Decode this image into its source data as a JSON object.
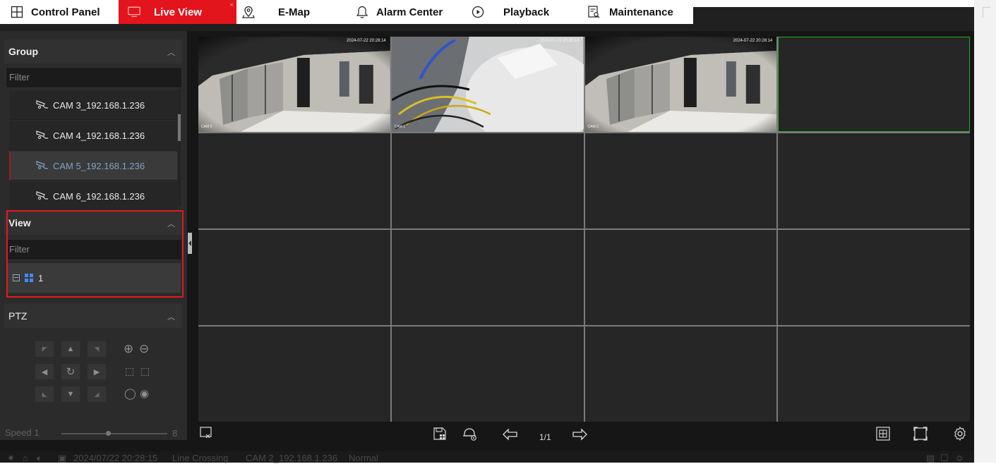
{
  "tabs": [
    {
      "label": "Control Panel",
      "icon": "grid-icon"
    },
    {
      "label": "Live View",
      "icon": "monitor-icon",
      "close": "×"
    },
    {
      "label": "E-Map",
      "icon": "map-pin-icon"
    },
    {
      "label": "Alarm Center",
      "icon": "bell-icon"
    },
    {
      "label": "Playback",
      "icon": "play-circle-icon"
    },
    {
      "label": "Maintenance",
      "icon": "maintenance-icon"
    }
  ],
  "sidebar": {
    "group": {
      "title": "Group",
      "filter_placeholder": "Filter",
      "cameras": [
        {
          "label": "CAM 3_192.168.1.236"
        },
        {
          "label": "CAM 4_192.168.1.236"
        },
        {
          "label": "CAM 5_192.168.1.236",
          "selected": true
        },
        {
          "label": "CAM 6_192.168.1.236"
        }
      ]
    },
    "view": {
      "title": "View",
      "filter_placeholder": "Filter",
      "items": [
        {
          "label": "1"
        }
      ]
    },
    "ptz": {
      "title": "PTZ"
    },
    "speed": {
      "label": "Speed",
      "value": "1",
      "max": "8"
    }
  },
  "video_cells": [
    {
      "timestamp": "2024-07-22 20:28:14",
      "label": "CAM 3"
    },
    {
      "timestamp": "2024-07-22 20:28:14",
      "label": "CAM 1"
    },
    {
      "timestamp": "2024-07-22 20:28:14",
      "label": "CAM 2"
    }
  ],
  "bottom_toolbar": {
    "page": "1/1"
  },
  "status_bar": {
    "datetime": "2024/07/22 20:28:15",
    "event": "Line Crossing",
    "camera": "CAM 2_192.168.1.236",
    "state": "Normal"
  },
  "colors": {
    "accent_red": "#e4141c",
    "selection_green": "#22b122",
    "view_icon_blue": "#3d8bff"
  }
}
